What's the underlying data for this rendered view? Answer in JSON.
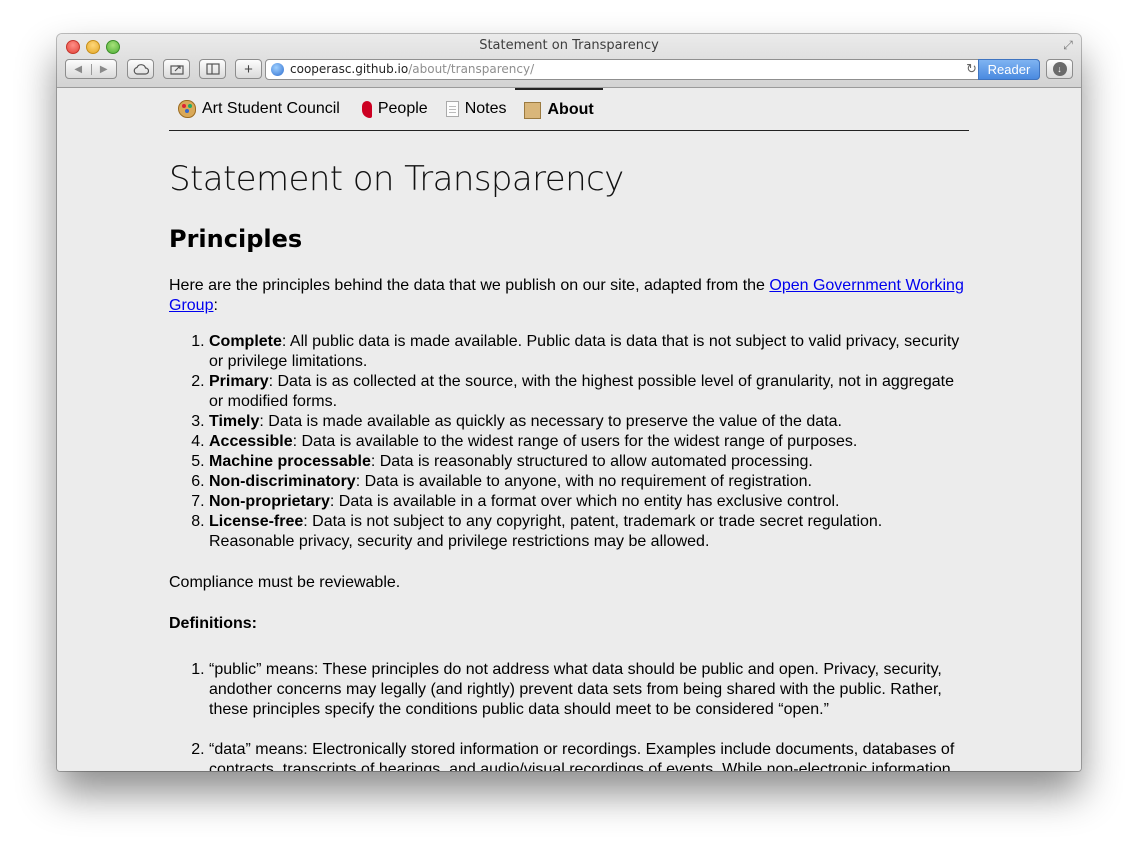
{
  "browser": {
    "window_title": "Statement on Transparency",
    "url_host": "cooperasc.github.io",
    "url_path": "/about/transparency/",
    "reader_label": "Reader",
    "new_tab_label": "+"
  },
  "nav": {
    "items": [
      {
        "label": "Art Student Council",
        "icon": "palette-icon"
      },
      {
        "label": "People",
        "icon": "dancer-icon"
      },
      {
        "label": "Notes",
        "icon": "page-icon"
      },
      {
        "label": "About",
        "icon": "scroll-icon",
        "active": true
      }
    ]
  },
  "page": {
    "title": "Statement on Transparency",
    "principles_heading": "Principles",
    "intro_before": "Here are the principles behind the data that we publish on our site, adapted from the ",
    "intro_link": "Open Government Working Group",
    "intro_after": ":",
    "principles": [
      {
        "term": "Complete",
        "text": ": All public data is made available. Public data is data that is not subject to valid privacy, security or privilege limitations."
      },
      {
        "term": "Primary",
        "text": ": Data is as collected at the source, with the highest possible level of granularity, not in aggregate or modified forms."
      },
      {
        "term": "Timely",
        "text": ": Data is made available as quickly as necessary to preserve the value of the data."
      },
      {
        "term": "Accessible",
        "text": ": Data is available to the widest range of users for the widest range of purposes."
      },
      {
        "term": "Machine processable",
        "text": ": Data is reasonably structured to allow automated processing."
      },
      {
        "term": "Non-discriminatory",
        "text": ": Data is available to anyone, with no requirement of registration."
      },
      {
        "term": "Non-proprietary",
        "text": ": Data is available in a format over which no entity has exclusive control."
      },
      {
        "term": "License-free",
        "text": ": Data is not subject to any copyright, patent, trademark or trade secret regulation. Reasonable privacy, security and privilege restrictions may be allowed."
      }
    ],
    "compliance": "Compliance must be reviewable.",
    "definitions_heading": "Definitions:",
    "definitions": [
      "“public” means: These principles do not address what data should be public and open. Privacy, security, andother concerns may legally (and rightly) prevent data sets from being shared with the public. Rather, these principles specify the conditions public data should meet to be considered “open.”",
      "“data” means: Electronically stored information or recordings. Examples include documents, databases of contracts, transcripts of hearings, and audio/visual recordings of events. While non-electronic information"
    ]
  }
}
